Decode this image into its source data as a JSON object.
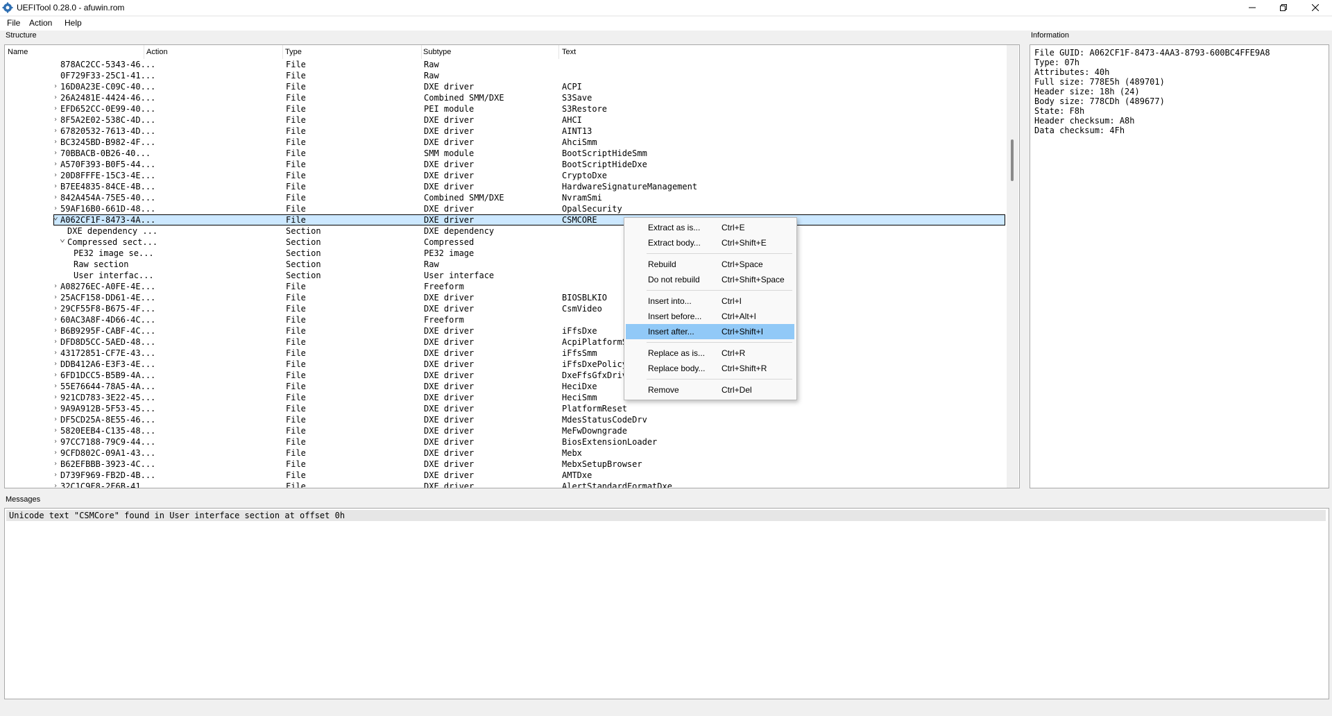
{
  "window": {
    "title": "UEFITool 0.28.0 - afuwin.rom"
  },
  "menu": [
    "File",
    "Action",
    "Help"
  ],
  "structure": {
    "label": "Structure",
    "columns": [
      "Name",
      "Action",
      "Type",
      "Subtype",
      "Text"
    ],
    "rows": [
      {
        "indent": 2,
        "arrow": "",
        "name": "878AC2CC-5343-46...",
        "type": "File",
        "subtype": "Raw",
        "text": ""
      },
      {
        "indent": 2,
        "arrow": "",
        "name": "0F729F33-25C1-41...",
        "type": "File",
        "subtype": "Raw",
        "text": ""
      },
      {
        "indent": 2,
        "arrow": ">",
        "name": "16D0A23E-C09C-40...",
        "type": "File",
        "subtype": "DXE driver",
        "text": "ACPI"
      },
      {
        "indent": 2,
        "arrow": ">",
        "name": "26A2481E-4424-46...",
        "type": "File",
        "subtype": "Combined SMM/DXE",
        "text": "S3Save"
      },
      {
        "indent": 2,
        "arrow": ">",
        "name": "EFD652CC-0E99-40...",
        "type": "File",
        "subtype": "PEI module",
        "text": "S3Restore"
      },
      {
        "indent": 2,
        "arrow": ">",
        "name": "8F5A2E02-538C-4D...",
        "type": "File",
        "subtype": "DXE driver",
        "text": "AHCI"
      },
      {
        "indent": 2,
        "arrow": ">",
        "name": "67820532-7613-4D...",
        "type": "File",
        "subtype": "DXE driver",
        "text": "AINT13"
      },
      {
        "indent": 2,
        "arrow": ">",
        "name": "BC3245BD-B982-4F...",
        "type": "File",
        "subtype": "DXE driver",
        "text": "AhciSmm"
      },
      {
        "indent": 2,
        "arrow": ">",
        "name": "70BBACB-0B26-40...",
        "type": "File",
        "subtype": "SMM module",
        "text": "BootScriptHideSmm"
      },
      {
        "indent": 2,
        "arrow": ">",
        "name": "A570F393-B0F5-44...",
        "type": "File",
        "subtype": "DXE driver",
        "text": "BootScriptHideDxe"
      },
      {
        "indent": 2,
        "arrow": ">",
        "name": "20D8FFFE-15C3-4E...",
        "type": "File",
        "subtype": "DXE driver",
        "text": "CryptoDxe"
      },
      {
        "indent": 2,
        "arrow": ">",
        "name": "B7EE4835-84CE-4B...",
        "type": "File",
        "subtype": "DXE driver",
        "text": "HardwareSignatureManagement"
      },
      {
        "indent": 2,
        "arrow": ">",
        "name": "842A454A-75E5-40...",
        "type": "File",
        "subtype": "Combined SMM/DXE",
        "text": "NvramSmi"
      },
      {
        "indent": 2,
        "arrow": ">",
        "name": "59AF16B0-661D-48...",
        "type": "File",
        "subtype": "DXE driver",
        "text": "OpalSecurity"
      },
      {
        "indent": 2,
        "arrow": "v",
        "name": "A062CF1F-8473-4A...",
        "type": "File",
        "subtype": "DXE driver",
        "text": "CSMCORE",
        "selected": true
      },
      {
        "indent": 3,
        "arrow": "",
        "name": "DXE dependency ...",
        "type": "Section",
        "subtype": "DXE dependency",
        "text": ""
      },
      {
        "indent": 3,
        "arrow": "v",
        "name": "Compressed sect...",
        "type": "Section",
        "subtype": "Compressed",
        "text": ""
      },
      {
        "indent": 4,
        "arrow": "",
        "name": "PE32 image se...",
        "type": "Section",
        "subtype": "PE32 image",
        "text": ""
      },
      {
        "indent": 4,
        "arrow": "",
        "name": "Raw section",
        "type": "Section",
        "subtype": "Raw",
        "text": ""
      },
      {
        "indent": 4,
        "arrow": "",
        "name": "User interfac...",
        "type": "Section",
        "subtype": "User interface",
        "text": ""
      },
      {
        "indent": 2,
        "arrow": ">",
        "name": "A08276EC-A0FE-4E...",
        "type": "File",
        "subtype": "Freeform",
        "text": ""
      },
      {
        "indent": 2,
        "arrow": ">",
        "name": "25ACF158-DD61-4E...",
        "type": "File",
        "subtype": "DXE driver",
        "text": "BIOSBLKIO"
      },
      {
        "indent": 2,
        "arrow": ">",
        "name": "29CF55F8-B675-4F...",
        "type": "File",
        "subtype": "DXE driver",
        "text": "CsmVideo"
      },
      {
        "indent": 2,
        "arrow": ">",
        "name": "60AC3A8F-4D66-4C...",
        "type": "File",
        "subtype": "Freeform",
        "text": ""
      },
      {
        "indent": 2,
        "arrow": ">",
        "name": "B6B9295F-CABF-4C...",
        "type": "File",
        "subtype": "DXE driver",
        "text": "iFfsDxe"
      },
      {
        "indent": 2,
        "arrow": ">",
        "name": "DFD8D5CC-5AED-48...",
        "type": "File",
        "subtype": "DXE driver",
        "text": "AcpiPlatformS"
      },
      {
        "indent": 2,
        "arrow": ">",
        "name": "43172851-CF7E-43...",
        "type": "File",
        "subtype": "DXE driver",
        "text": "iFfsSmm"
      },
      {
        "indent": 2,
        "arrow": ">",
        "name": "DDB412A6-E3F3-4E...",
        "type": "File",
        "subtype": "DXE driver",
        "text": "iFfsDxePolicy"
      },
      {
        "indent": 2,
        "arrow": ">",
        "name": "6FD1DCC5-B5B9-4A...",
        "type": "File",
        "subtype": "DXE driver",
        "text": "DxeFfsGfxDriv"
      },
      {
        "indent": 2,
        "arrow": ">",
        "name": "55E76644-78A5-4A...",
        "type": "File",
        "subtype": "DXE driver",
        "text": "HeciDxe"
      },
      {
        "indent": 2,
        "arrow": ">",
        "name": "921CD783-3E22-45...",
        "type": "File",
        "subtype": "DXE driver",
        "text": "HeciSmm"
      },
      {
        "indent": 2,
        "arrow": ">",
        "name": "9A9A912B-5F53-45...",
        "type": "File",
        "subtype": "DXE driver",
        "text": "PlatformReset"
      },
      {
        "indent": 2,
        "arrow": ">",
        "name": "DF5CD25A-8E55-46...",
        "type": "File",
        "subtype": "DXE driver",
        "text": "MdesStatusCodeDrv"
      },
      {
        "indent": 2,
        "arrow": ">",
        "name": "5820EEB4-C135-48...",
        "type": "File",
        "subtype": "DXE driver",
        "text": "MeFwDowngrade"
      },
      {
        "indent": 2,
        "arrow": ">",
        "name": "97CC7188-79C9-44...",
        "type": "File",
        "subtype": "DXE driver",
        "text": "BiosExtensionLoader"
      },
      {
        "indent": 2,
        "arrow": ">",
        "name": "9CFD802C-09A1-43...",
        "type": "File",
        "subtype": "DXE driver",
        "text": "Mebx"
      },
      {
        "indent": 2,
        "arrow": ">",
        "name": "B62EFBBB-3923-4C...",
        "type": "File",
        "subtype": "DXE driver",
        "text": "MebxSetupBrowser"
      },
      {
        "indent": 2,
        "arrow": ">",
        "name": "D739F969-FB2D-4B...",
        "type": "File",
        "subtype": "DXE driver",
        "text": "AMTDxe"
      },
      {
        "indent": 2,
        "arrow": ">",
        "name": "32C1C9F8-2F6B-41...",
        "type": "File",
        "subtype": "DXE driver",
        "text": "AlertStandardFormatDxe"
      }
    ]
  },
  "information": {
    "label": "Information",
    "lines": [
      "File GUID: A062CF1F-8473-4AA3-8793-600BC4FFE9A8",
      "Type: 07h",
      "Attributes: 40h",
      "Full size: 778E5h (489701)",
      "Header size: 18h (24)",
      "Body size: 778CDh (489677)",
      "State: F8h",
      "Header checksum: A8h",
      "Data checksum: 4Fh"
    ]
  },
  "messages": {
    "label": "Messages",
    "items": [
      "Unicode text \"CSMCore\" found in User interface section at offset 0h"
    ]
  },
  "context_menu": {
    "groups": [
      [
        {
          "label": "Extract as is...",
          "shortcut": "Ctrl+E"
        },
        {
          "label": "Extract body...",
          "shortcut": "Ctrl+Shift+E"
        }
      ],
      [
        {
          "label": "Rebuild",
          "shortcut": "Ctrl+Space"
        },
        {
          "label": "Do not rebuild",
          "shortcut": "Ctrl+Shift+Space"
        }
      ],
      [
        {
          "label": "Insert into...",
          "shortcut": "Ctrl+I"
        },
        {
          "label": "Insert before...",
          "shortcut": "Ctrl+Alt+I"
        },
        {
          "label": "Insert after...",
          "shortcut": "Ctrl+Shift+I",
          "highlighted": true
        }
      ],
      [
        {
          "label": "Replace as is...",
          "shortcut": "Ctrl+R"
        },
        {
          "label": "Replace body...",
          "shortcut": "Ctrl+Shift+R"
        }
      ],
      [
        {
          "label": "Remove",
          "shortcut": "Ctrl+Del"
        }
      ]
    ]
  },
  "icons": {
    "app": "gear-icon",
    "minimize": "minimize-icon",
    "maximize": "restore-icon",
    "close": "close-icon"
  },
  "colors": {
    "selection": "#cce8ff",
    "menu_highlight": "#91c9f7"
  }
}
